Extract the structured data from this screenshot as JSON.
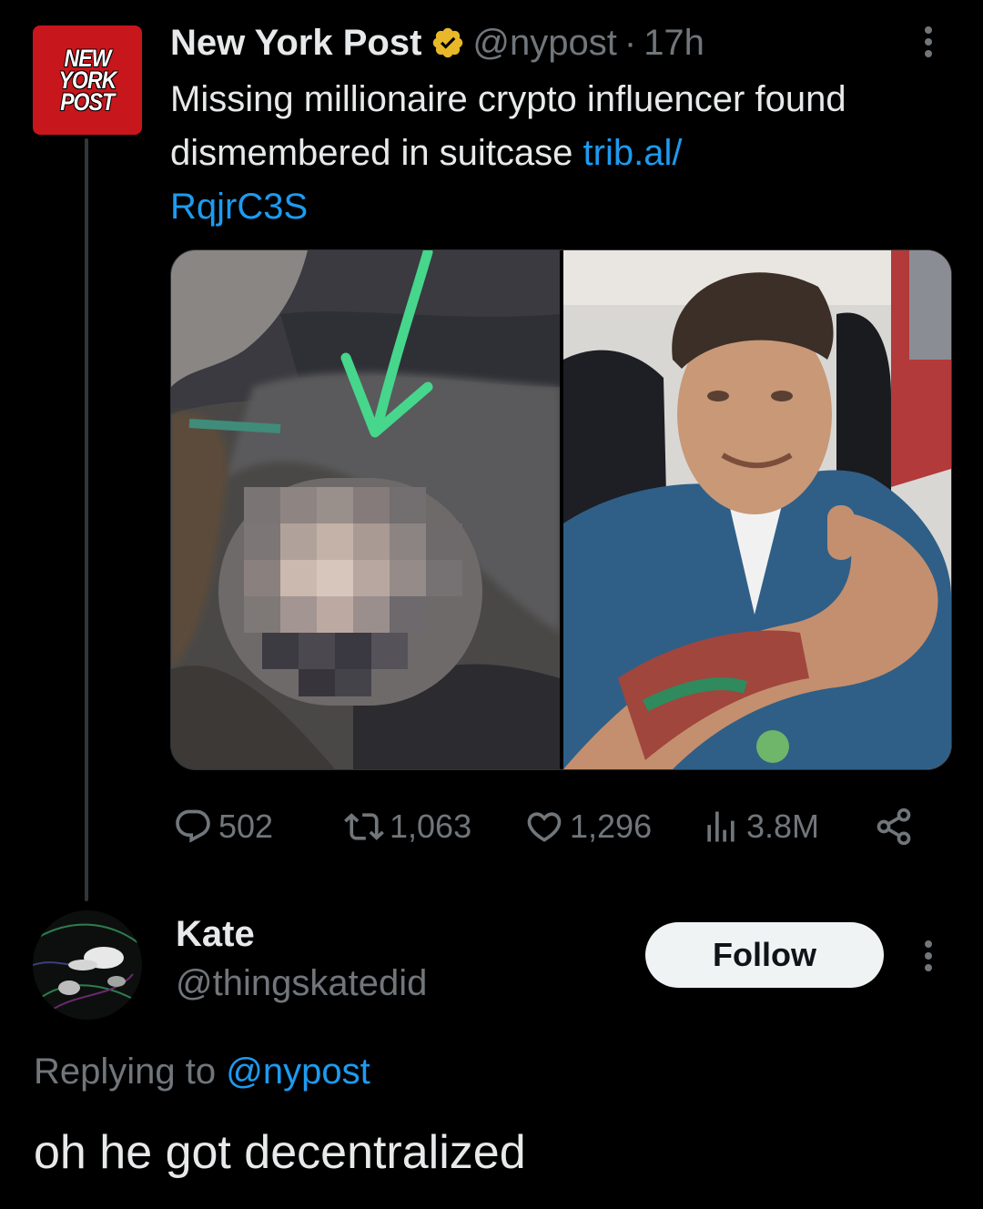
{
  "parent_tweet": {
    "logo_text": [
      "NEW",
      "YORK",
      "POST"
    ],
    "display_name": "New York Post",
    "verified_badge": "gold-verified-icon",
    "handle": "@nypost",
    "separator": "·",
    "time": "17h",
    "text": "Missing millionaire crypto influencer found dismembered in suitcase ",
    "link": "trib.al/RqjrC3S",
    "link_line1": "trib.al/",
    "link_line2": "RqjrC3S",
    "media": {
      "left_image": "pixelated-crime-scene-photo",
      "right_image": "man-selfie-thumbs-up"
    },
    "actions": {
      "replies": "502",
      "reposts": "1,063",
      "likes": "1,296",
      "views": "3.8M"
    }
  },
  "reply": {
    "display_name": "Kate",
    "handle": "@thingskatedid",
    "follow_label": "Follow",
    "replying_prefix": "Replying to ",
    "replying_to": "@nypost",
    "text": "oh he got decentralized"
  },
  "colors": {
    "background": "#000000",
    "text": "#e7e9ea",
    "muted": "#71767b",
    "link": "#1d9bf0",
    "nyp_red": "#c8161d",
    "verified_gold": "#e8b829"
  }
}
